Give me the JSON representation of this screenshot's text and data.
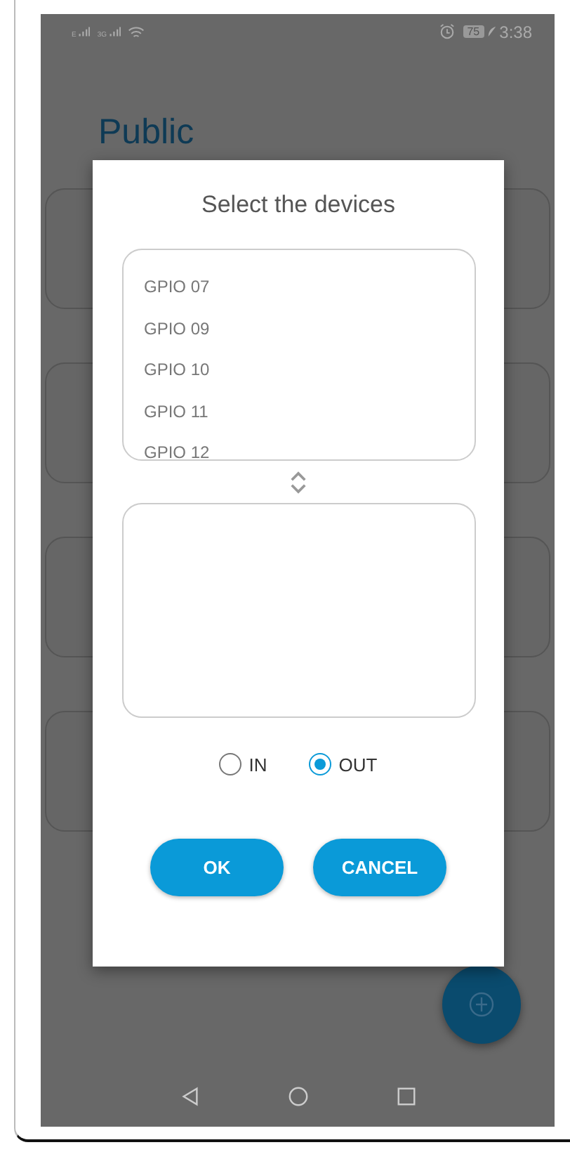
{
  "status_bar": {
    "network_1": "E",
    "network_2": "3G",
    "battery": "75",
    "time": "3:38"
  },
  "page": {
    "title": "Public"
  },
  "dialog": {
    "title": "Select the devices",
    "devices": [
      {
        "label": "GPIO 07",
        "selected": false
      },
      {
        "label": "GPIO 09",
        "selected": false
      },
      {
        "label": "GPIO 10",
        "selected": false
      },
      {
        "label": "GPIO 11",
        "selected": false
      },
      {
        "label": "GPIO 12",
        "selected": false
      }
    ],
    "directions": [
      {
        "label": "IN",
        "selected": false
      },
      {
        "label": "OUT",
        "selected": true
      }
    ],
    "buttons": [
      "OK",
      "CANCEL"
    ]
  }
}
